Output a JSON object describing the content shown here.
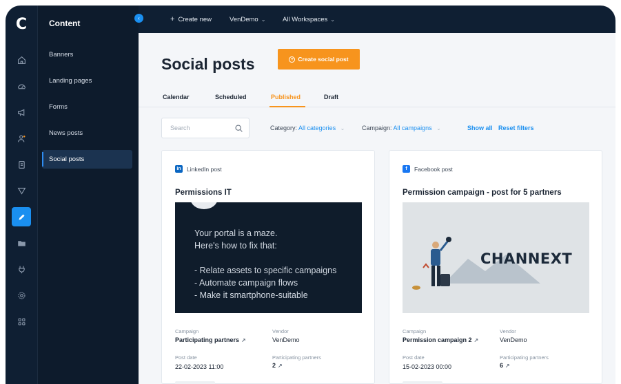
{
  "app": {
    "logo": "C"
  },
  "rail": [
    "home-icon",
    "dashboard-icon",
    "megaphone-icon",
    "users-icon",
    "document-icon",
    "filter-icon",
    "pencil-icon",
    "folder-icon",
    "plug-icon",
    "settings-icon",
    "apps-icon"
  ],
  "sidebar": {
    "title": "Content",
    "items": [
      {
        "label": "Banners"
      },
      {
        "label": "Landing pages"
      },
      {
        "label": "Forms"
      },
      {
        "label": "News posts"
      },
      {
        "label": "Social posts"
      }
    ]
  },
  "topbar": {
    "create_new": "Create new",
    "vendor": "VenDemo",
    "workspaces": "All Workspaces"
  },
  "header": {
    "title": "Social posts",
    "create_button": "Create social post",
    "tabs": [
      {
        "label": "Calendar"
      },
      {
        "label": "Scheduled"
      },
      {
        "label": "Published"
      },
      {
        "label": "Draft"
      }
    ]
  },
  "filters": {
    "search_placeholder": "Search",
    "category_label": "Category:",
    "category_value": "All categories",
    "campaign_label": "Campaign:",
    "campaign_value": "All campaigns",
    "show_all": "Show all",
    "reset": "Reset filters"
  },
  "posts": [
    {
      "type": "LinkedIn post",
      "title": "Permissions IT",
      "image_lines": [
        "Your portal is a maze.",
        "Here's how to fix that:",
        "",
        "- Relate assets to specific campaigns",
        "- Automate campaign flows",
        "- Make it smartphone-suitable"
      ],
      "campaign_label": "Campaign",
      "campaign": "Participating partners",
      "vendor_label": "Vendor",
      "vendor": "VenDemo",
      "date_label": "Post date",
      "date": "22-02-2023 11:00",
      "partners_label": "Participating partners",
      "partners": "2"
    },
    {
      "type": "Facebook post",
      "title": "Permission campaign - post for 5 partners",
      "image_brand": "CHANNEXT",
      "campaign_label": "Campaign",
      "campaign": "Permission campaign 2",
      "vendor_label": "Vendor",
      "vendor": "VenDemo",
      "date_label": "Post date",
      "date": "15-02-2023 00:00",
      "partners_label": "Participating partners",
      "partners": "6"
    }
  ],
  "colors": {
    "accent": "#f7941d",
    "link": "#1a8ff0",
    "nav": "#0f1f33"
  }
}
